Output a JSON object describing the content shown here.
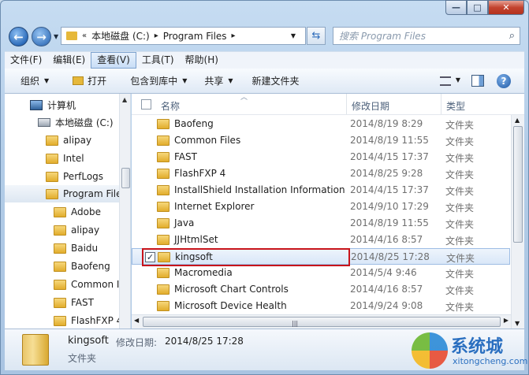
{
  "window": {
    "caption_min": "—",
    "caption_max": "□",
    "caption_close": "✕"
  },
  "nav": {
    "back": "←",
    "forward": "→",
    "refresh": "⇆"
  },
  "address": {
    "prefix": "«",
    "crumbs": [
      "本地磁盘 (C:)",
      "Program Files"
    ],
    "sep": "▸"
  },
  "search": {
    "placeholder": "搜索 Program Files",
    "icon": "⌕"
  },
  "menu": [
    "文件(F)",
    "编辑(E)",
    "查看(V)",
    "工具(T)",
    "帮助(H)"
  ],
  "menu_active_index": 2,
  "commands": {
    "organize": "组织",
    "open": "打开",
    "include": "包含到库中",
    "share": "共享",
    "new_folder": "新建文件夹",
    "help": "?"
  },
  "nav_tree": [
    {
      "label": "计算机",
      "icon": "computer-icon"
    },
    {
      "label": "本地磁盘 (C:)",
      "icon": "drive-icon"
    },
    {
      "label": "alipay",
      "icon": "folder-icon"
    },
    {
      "label": "Intel",
      "icon": "folder-icon"
    },
    {
      "label": "PerfLogs",
      "icon": "folder-icon"
    },
    {
      "label": "Program File",
      "icon": "folder-icon",
      "selected": true
    },
    {
      "label": "Adobe",
      "icon": "folder-icon"
    },
    {
      "label": "alipay",
      "icon": "folder-icon"
    },
    {
      "label": "Baidu",
      "icon": "folder-icon"
    },
    {
      "label": "Baofeng",
      "icon": "folder-icon"
    },
    {
      "label": "Common I",
      "icon": "folder-icon"
    },
    {
      "label": "FAST",
      "icon": "folder-icon"
    },
    {
      "label": "FlashFXP 4",
      "icon": "folder-icon"
    }
  ],
  "columns": {
    "name": "名称",
    "date": "修改日期",
    "type": "类型"
  },
  "files": [
    {
      "name": "Baofeng",
      "date": "2014/8/19 8:29",
      "type": "文件夹"
    },
    {
      "name": "Common Files",
      "date": "2014/8/19 11:55",
      "type": "文件夹"
    },
    {
      "name": "FAST",
      "date": "2014/4/15 17:37",
      "type": "文件夹"
    },
    {
      "name": "FlashFXP 4",
      "date": "2014/8/25 9:28",
      "type": "文件夹"
    },
    {
      "name": "InstallShield Installation Information",
      "date": "2014/4/15 17:37",
      "type": "文件夹"
    },
    {
      "name": "Internet Explorer",
      "date": "2014/9/10 17:29",
      "type": "文件夹"
    },
    {
      "name": "Java",
      "date": "2014/8/19 11:55",
      "type": "文件夹"
    },
    {
      "name": "JJHtmlSet",
      "date": "2014/4/16 8:57",
      "type": "文件夹"
    },
    {
      "name": "kingsoft",
      "date": "2014/8/25 17:28",
      "type": "文件夹",
      "selected": true,
      "checked": true
    },
    {
      "name": "Macromedia",
      "date": "2014/5/4 9:46",
      "type": "文件夹"
    },
    {
      "name": "Microsoft Chart Controls",
      "date": "2014/4/16 8:57",
      "type": "文件夹"
    },
    {
      "name": "Microsoft Device Health",
      "date": "2014/9/24 9:08",
      "type": "文件夹"
    }
  ],
  "details": {
    "name": "kingsoft",
    "date_label": "修改日期:",
    "date": "2014/8/25 17:28",
    "type": "文件夹"
  },
  "watermark": {
    "text": "系统城",
    "sub": "xitongcheng.com"
  },
  "colors": {
    "highlight": "#c8141b",
    "selection": "#d9e7f8",
    "accent": "#2d6cbb"
  }
}
